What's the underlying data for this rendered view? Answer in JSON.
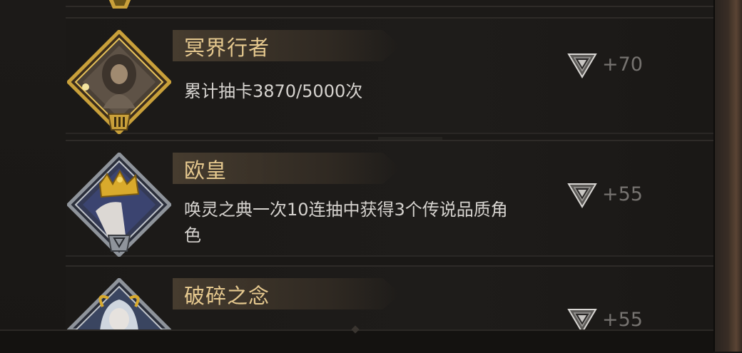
{
  "achievements": [
    {
      "title": "冥界行者",
      "description": "累计抽卡3870/5000次",
      "reward": "+70",
      "portrait_icon": "hooded-wanderer-portrait-icon"
    },
    {
      "title": "欧皇",
      "description": "唤灵之典一次10连抽中获得3个传说品质角色",
      "reward": "+55",
      "portrait_icon": "crowned-king-portrait-icon"
    },
    {
      "title": "破碎之念",
      "description": "",
      "reward": "+55",
      "portrait_icon": "horned-warrior-portrait-icon"
    }
  ],
  "colors": {
    "title": "#e6c98f",
    "description": "#d6d3cf",
    "reward": "#767370",
    "gold_frame": "#c9a03a",
    "silver_frame": "#8f949b"
  }
}
